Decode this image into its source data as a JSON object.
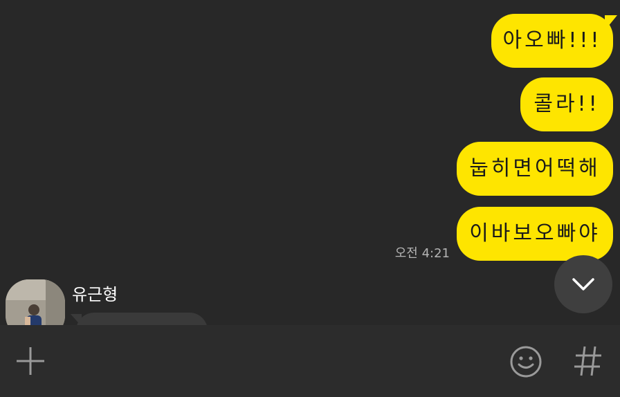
{
  "colors": {
    "background": "#282828",
    "my_bubble": "#FEE500",
    "input_bar": "#2c2c2c",
    "scroll_button": "#3f3f3f"
  },
  "messages": {
    "outgoing": [
      {
        "text": "아오빠!!!"
      },
      {
        "text": "콜라!!"
      },
      {
        "text": "눕히면어떡해"
      },
      {
        "text": "이바보오빠야"
      }
    ],
    "timestamp": "오전 4:21"
  },
  "incoming": {
    "sender_name": "유근형"
  },
  "icons": {
    "scroll_down": "chevron-down-icon",
    "attach": "plus-icon",
    "emoji": "smiley-icon",
    "hashtag": "hashtag-icon"
  }
}
